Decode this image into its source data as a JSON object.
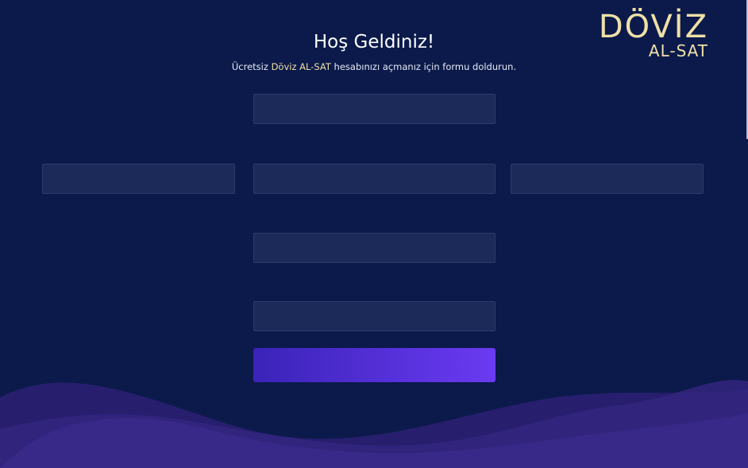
{
  "logo": {
    "main": "DÖVİZ",
    "sub": "AL-SAT"
  },
  "header": {
    "title": "Hoş Geldiniz!",
    "subtitle_before": "Ücretsiz ",
    "subtitle_brand": "Döviz AL-SAT",
    "subtitle_after": " hesabınızı açmanız için formu doldurun."
  },
  "form": {
    "field_1": {
      "value": "",
      "placeholder": ""
    },
    "field_2_left": {
      "value": "",
      "placeholder": ""
    },
    "field_2_center": {
      "value": "",
      "placeholder": ""
    },
    "field_2_right": {
      "value": "",
      "placeholder": ""
    },
    "field_3": {
      "value": "",
      "placeholder": ""
    },
    "field_4": {
      "value": "",
      "placeholder": ""
    },
    "submit_label": ""
  },
  "colors": {
    "background": "#0b1a4a",
    "accent_gold": "#efe0a8",
    "field_bg": "#1b2a58",
    "button_gradient_start": "#3a23b8",
    "button_gradient_end": "#6b3af2",
    "wave": "#3a2a8a"
  }
}
